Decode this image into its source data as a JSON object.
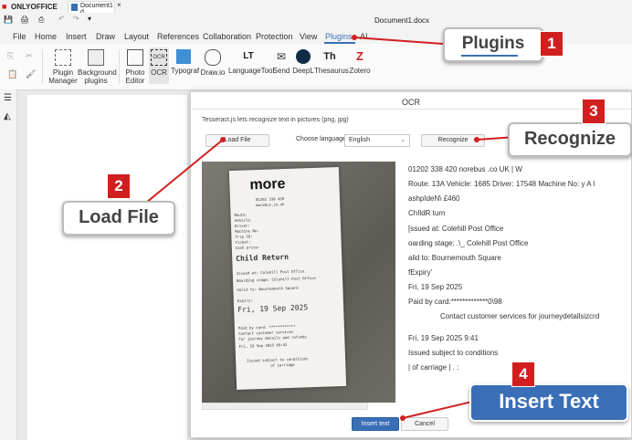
{
  "app": {
    "brand": "ONLYOFFICE",
    "tab_title": "Document1 d...",
    "window_title": "Document1.docx"
  },
  "menu": [
    "File",
    "Home",
    "Insert",
    "Draw",
    "Layout",
    "References",
    "Collaboration",
    "Protection",
    "View",
    "Plugins",
    "AI"
  ],
  "toolbar": {
    "plugin_manager": "Plugin Manager",
    "background_plugins": "Background plugins",
    "photo_editor": "Photo Editor",
    "ocr": "OCR",
    "typograf": "Typograf",
    "drawio": "Draw.io",
    "languagetool": "LanguageTool",
    "send": "Send",
    "deepl": "DeepL",
    "thesaurus": "Thesaurus",
    "zotero": "Zotero"
  },
  "dialog": {
    "title": "OCR",
    "description": "Tesseract.js lets recognize text in pictures (png, jpg)",
    "load_file": "Load File",
    "choose_language_label": "Choose language",
    "language_value": "English",
    "recognize": "Recognize",
    "insert_text": "Insert text",
    "cancel": "Cancel",
    "recognized_lines": [
      "01202 338 420 norebus  .co  UK | W",
      "Route: 13A Vehicle: 1685 Driver: 17548 Machine No: y A l",
      "ashpIdeN\\ £460",
      "ChIldR turn",
      "[ssued at: Colehill Post Office",
      "oarding stage: .\\_ Colehill Post Office",
      "alid to: Bournemouth Square",
      "fExpiry'",
      "Fri, 19 Sep 2025",
      "Paid by card:*************0\\98",
      "Contact customer services for journeydetallsizcrd",
      "",
      "Fri, 19 Sep 2025 9:41",
      "Issued subject to conditions",
      "| of carriage | . :"
    ]
  },
  "receipt": {
    "logo": "more",
    "phone": "01202 338 420",
    "site": "morebus.co.uk",
    "route": "Route:",
    "vehicle": "Vehicle:",
    "driver": "Driver:",
    "machine": "Machine No:",
    "trip": "Trip ID:",
    "ticket": "Ticket:",
    "cash": "Cash price:",
    "child_return": "Child Return",
    "issued": "Issued at:   Colehill Post Office",
    "boarding": "Boarding stage:  Colehill Post Office",
    "valid": "Valid to:   Bournemouth Square",
    "expiry": "Expiry:",
    "date": "Fri, 19 Sep 2025",
    "paid": "Paid by card: ************",
    "contact1": "Contact customer services",
    "contact2": "for journey details and refunds",
    "date2": "Fri, 19 Sep 2025        09:41",
    "issued_sub": "Issued subject to conditions",
    "carriage": "of carriage"
  },
  "callouts": [
    {
      "num": "1",
      "label": "Plugins"
    },
    {
      "num": "2",
      "label": "Load File"
    },
    {
      "num": "3",
      "label": "Recognize"
    },
    {
      "num": "4",
      "label": "Insert Text"
    }
  ],
  "colors": {
    "accent": "#3a6fb7",
    "callout_red": "#d11f1f",
    "brand_red": "#d11f1f"
  }
}
